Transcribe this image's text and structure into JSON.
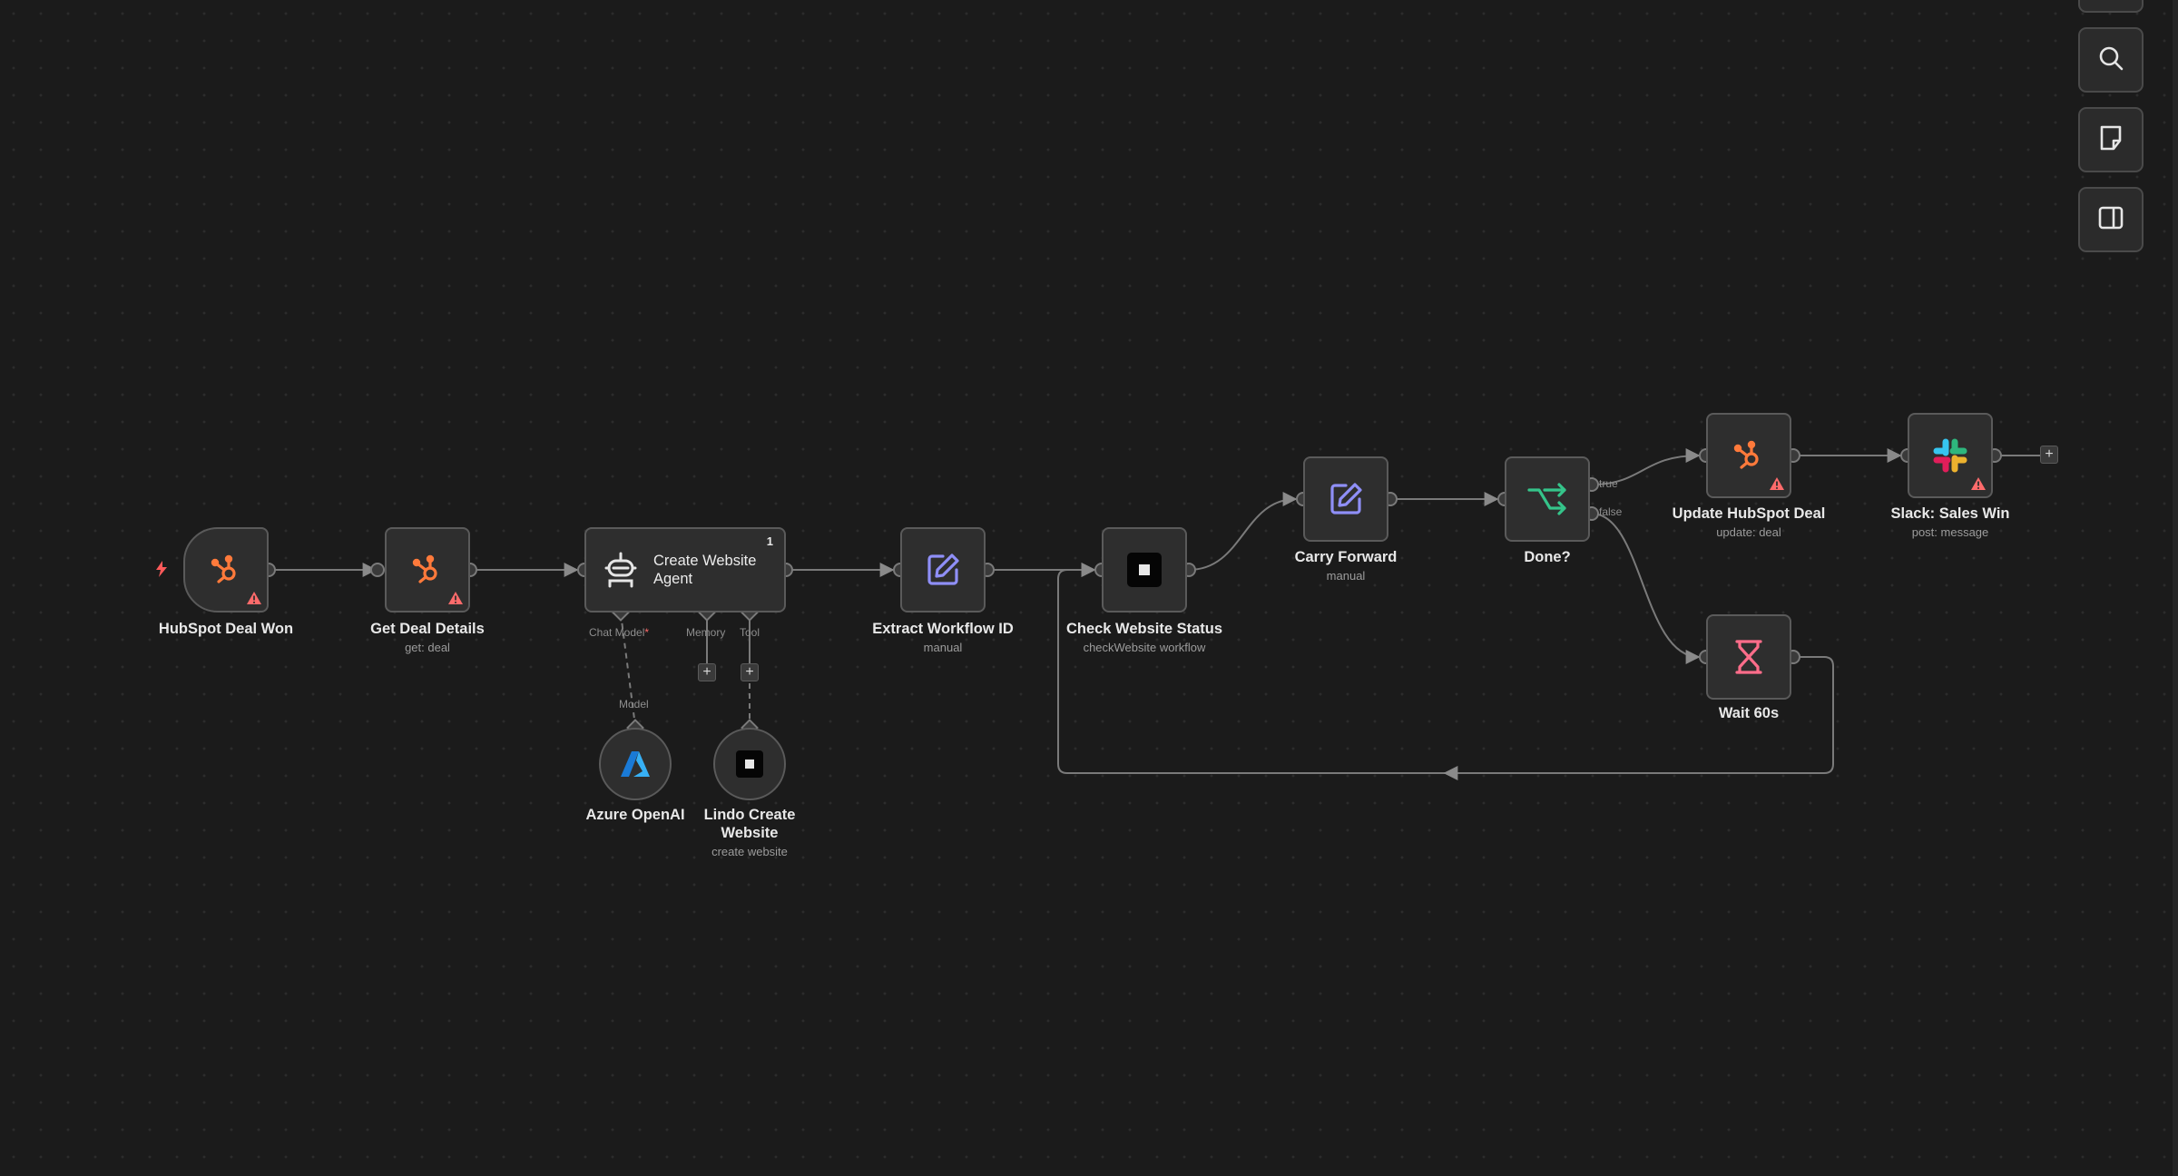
{
  "nodes": {
    "hubspot_deal_won": {
      "label": "HubSpot Deal Won",
      "icon": "hubspot-icon"
    },
    "get_deal_details": {
      "label": "Get Deal Details",
      "subtitle": "get: deal",
      "icon": "hubspot-icon"
    },
    "create_website_agent": {
      "label": "Create Website Agent",
      "badge": "1",
      "icon": "robot-icon"
    },
    "extract_workflow_id": {
      "label": "Extract Workflow ID",
      "subtitle": "manual",
      "icon": "edit-icon"
    },
    "check_website_status": {
      "label": "Check Website Status",
      "subtitle": "checkWebsite workflow",
      "icon": "lindo-icon"
    },
    "carry_forward": {
      "label": "Carry Forward",
      "subtitle": "manual",
      "icon": "edit-icon"
    },
    "done": {
      "label": "Done?",
      "icon": "if-branch-icon"
    },
    "update_hubspot_deal": {
      "label": "Update HubSpot Deal",
      "subtitle": "update: deal",
      "icon": "hubspot-icon"
    },
    "slack_sales_win": {
      "label": "Slack: Sales Win",
      "subtitle": "post: message",
      "icon": "slack-icon"
    },
    "wait_60s": {
      "label": "Wait 60s",
      "icon": "hourglass-icon"
    },
    "azure_openai": {
      "label": "Azure OpenAI",
      "icon": "azure-icon"
    },
    "lindo_create_website": {
      "label": "Lindo Create Website",
      "subtitle": "create website",
      "icon": "lindo-icon"
    }
  },
  "agent_ports": {
    "chat_model": "Chat Model",
    "required_mark": "*",
    "memory": "Memory",
    "tool": "Tool",
    "model": "Model"
  },
  "branch_labels": {
    "true": "true",
    "false": "false"
  },
  "toolbar": {
    "items": [
      "search-icon",
      "sticky-note-icon",
      "sidebar-toggle-icon"
    ]
  },
  "colors": {
    "hubspot": "#ff7a3b",
    "edit": "#8f8ff7",
    "if": "#35c48a",
    "wait": "#ff6d8a",
    "warning": "#ff6b6b"
  }
}
